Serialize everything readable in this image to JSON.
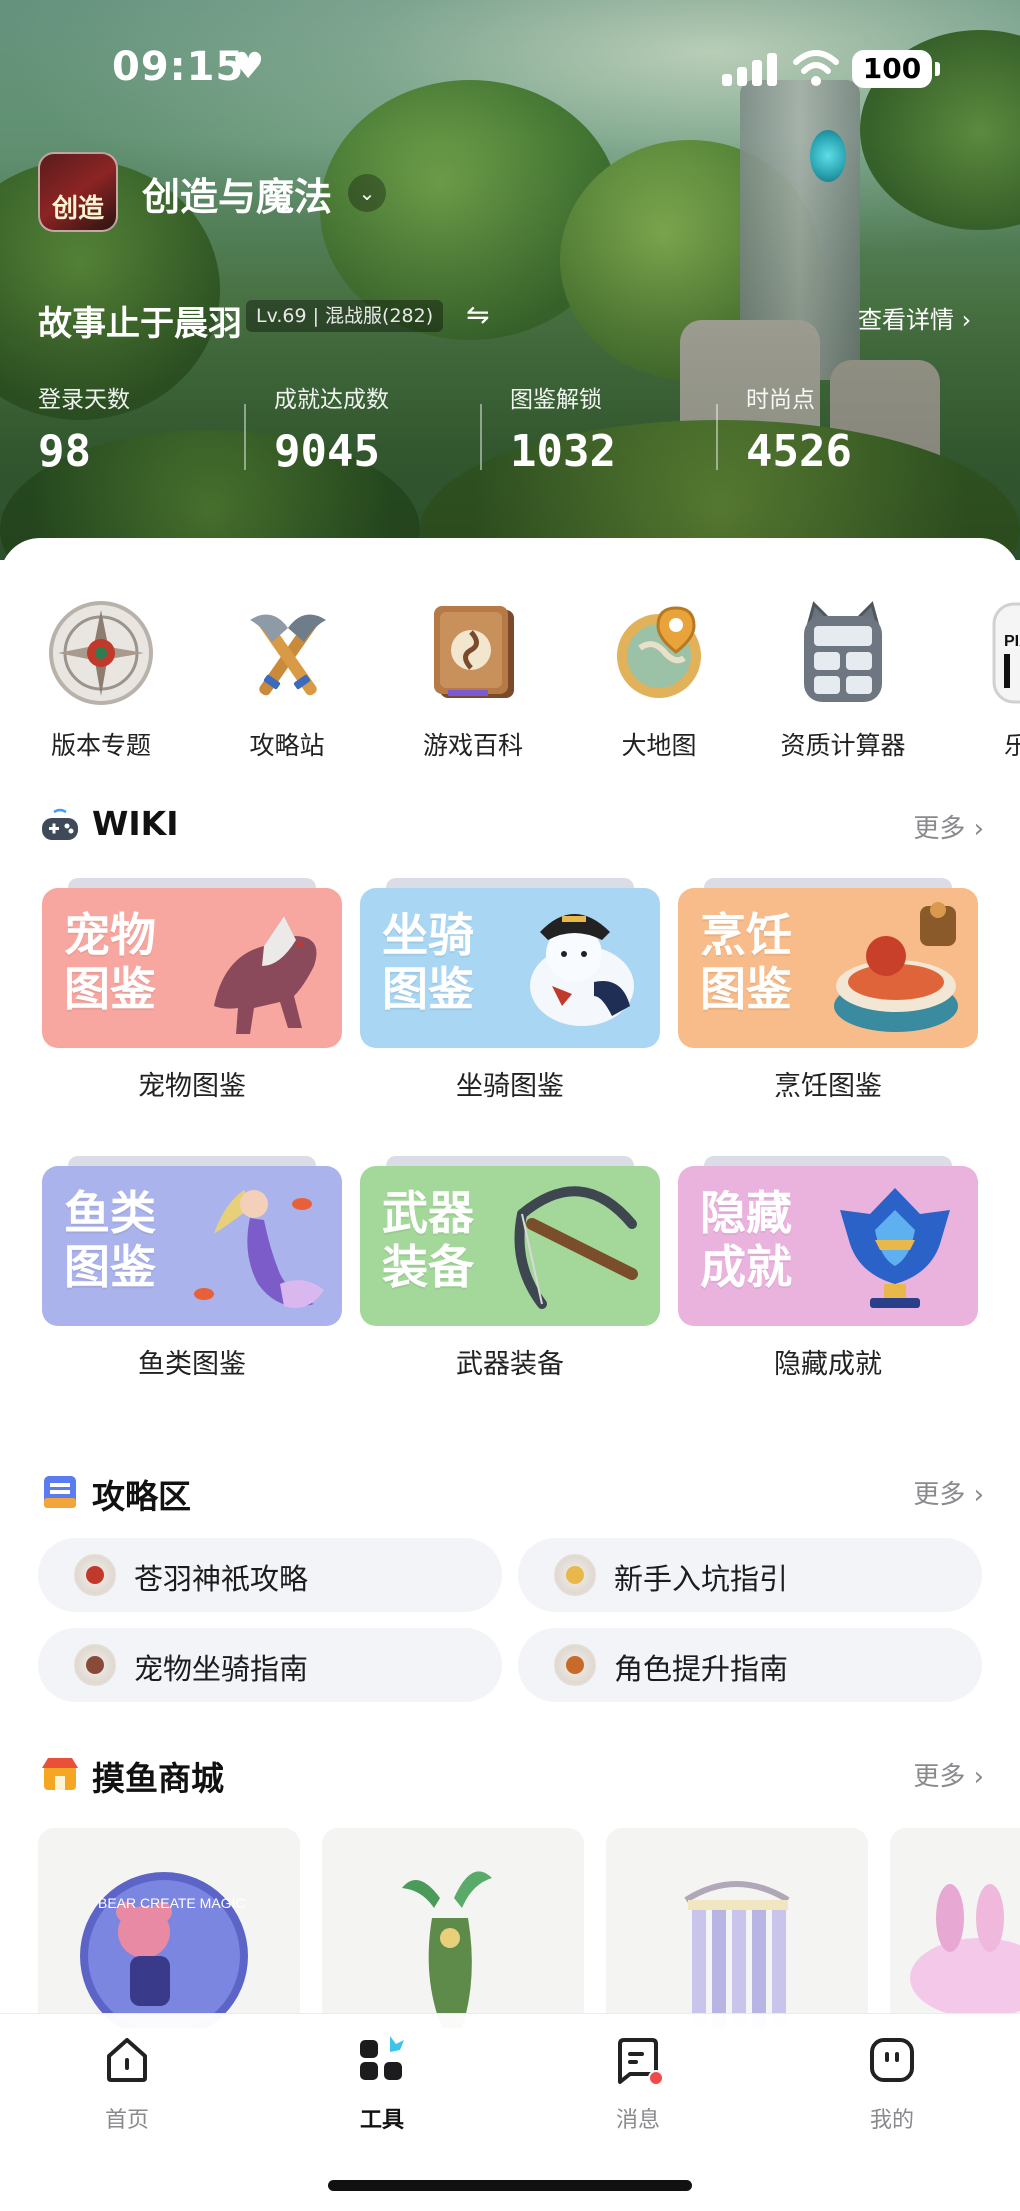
{
  "status_bar": {
    "time": "09:15",
    "battery": "100"
  },
  "app": {
    "name": "创造与魔法",
    "logo_text": "创造"
  },
  "user": {
    "name": "故事止于晨羽",
    "level": "Lv.69 | 混战服(282)",
    "switch_icon": "⇋",
    "detail_link": "查看详情 ›"
  },
  "stats": [
    {
      "label": "登录天数",
      "value": "98"
    },
    {
      "label": "成就达成数",
      "value": "9045"
    },
    {
      "label": "图鉴解锁",
      "value": "1032"
    },
    {
      "label": "时尚点",
      "value": "4526"
    }
  ],
  "tools": [
    {
      "label": "版本专题",
      "icon": "compass-emblem-icon"
    },
    {
      "label": "攻略站",
      "icon": "crossed-axes-icon"
    },
    {
      "label": "游戏百科",
      "icon": "book-icon"
    },
    {
      "label": "大地图",
      "icon": "map-pin-icon"
    },
    {
      "label": "资质计算器",
      "icon": "calculator-icon"
    },
    {
      "label": "乐谱",
      "icon": "piano-icon",
      "art_text": "PIANO"
    }
  ],
  "wiki": {
    "title": "WIKI",
    "more": "更多 ›",
    "cards": [
      {
        "big": "宠物\n图鉴",
        "caption": "宠物图鉴",
        "bg": "#f7a7a0",
        "icon": "wolf-icon"
      },
      {
        "big": "坐骑\n图鉴",
        "caption": "坐骑图鉴",
        "bg": "#a9d6f2",
        "icon": "seal-pirate-icon"
      },
      {
        "big": "烹饪\n图鉴",
        "caption": "烹饪图鉴",
        "bg": "#f8bb8a",
        "icon": "food-pot-icon"
      },
      {
        "big": "鱼类\n图鉴",
        "caption": "鱼类图鉴",
        "bg": "#aab3eb",
        "icon": "mermaid-icon"
      },
      {
        "big": "武器\n装备",
        "caption": "武器装备",
        "bg": "#a3d89a",
        "icon": "crossbow-icon"
      },
      {
        "big": "隐藏\n成就",
        "caption": "隐藏成就",
        "bg": "#eab3de",
        "icon": "trophy-mask-icon"
      }
    ]
  },
  "guides": {
    "title": "攻略区",
    "more": "更多 ›",
    "items": [
      {
        "label": "苍羽神祇攻略"
      },
      {
        "label": "新手入坑指引"
      },
      {
        "label": "宠物坐骑指南"
      },
      {
        "label": "角色提升指南"
      }
    ]
  },
  "shop": {
    "title": "摸鱼商城",
    "more": "更多 ›",
    "items": [
      {
        "icon": "badge-icon",
        "art_text": "BEAR CREATE MAGIC"
      },
      {
        "icon": "plant-bottle-icon"
      },
      {
        "icon": "curtain-icon"
      },
      {
        "icon": "plush-icon"
      }
    ]
  },
  "nav": [
    {
      "label": "首页",
      "icon": "home-icon",
      "active": false
    },
    {
      "label": "工具",
      "icon": "tools-grid-icon",
      "active": true
    },
    {
      "label": "消息",
      "icon": "message-icon",
      "active": false
    },
    {
      "label": "我的",
      "icon": "profile-icon",
      "active": false
    }
  ]
}
